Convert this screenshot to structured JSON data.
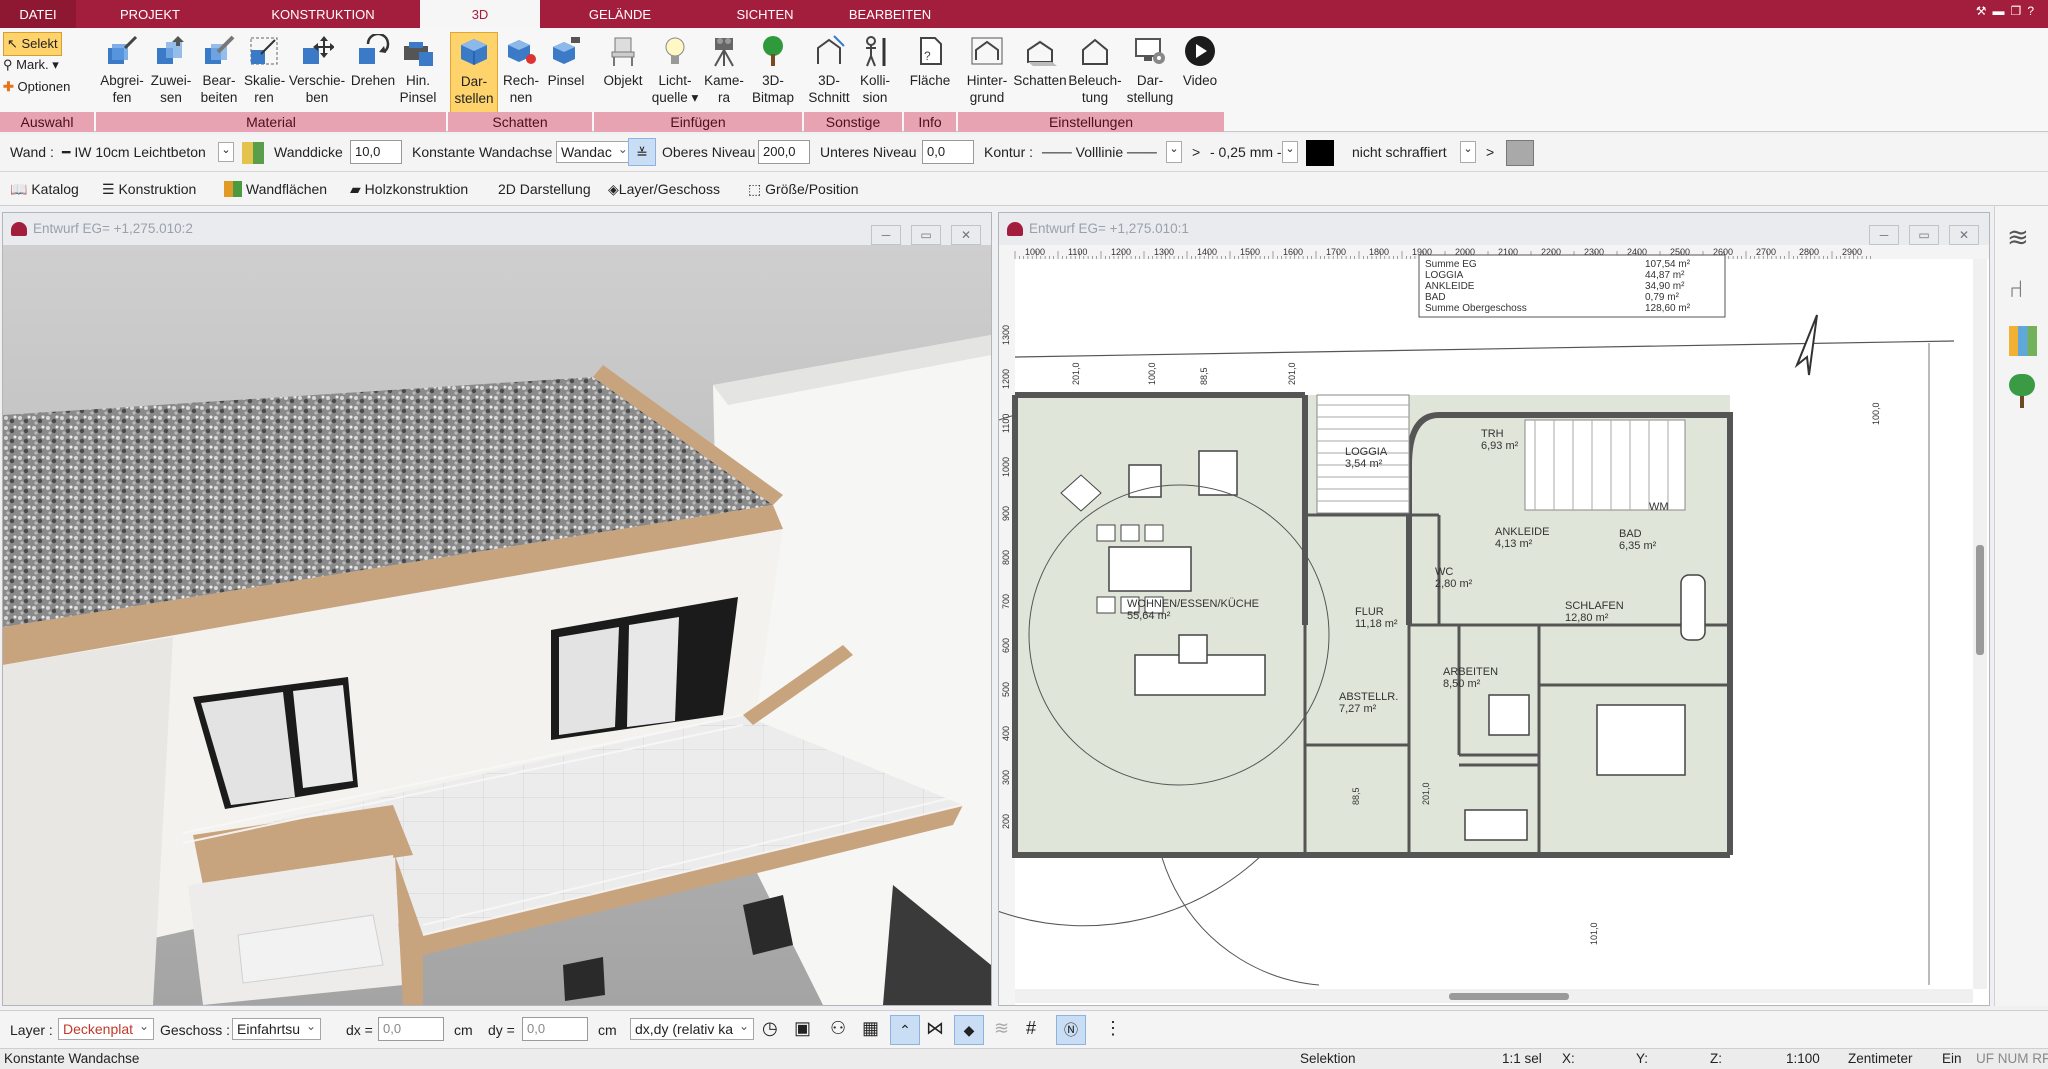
{
  "menu": {
    "tabs": [
      "DATEI",
      "PROJEKT",
      "KONSTRUKTION",
      "3D",
      "GELÄNDE",
      "SICHTEN",
      "BEARBEITEN"
    ],
    "active": "3D"
  },
  "ribbon": {
    "auswahl": {
      "selekt": "Selekt",
      "mark": "Mark.",
      "optionen": "Optionen"
    },
    "buttons": [
      {
        "l1": "Abgrei-",
        "l2": "fen"
      },
      {
        "l1": "Zuwei-",
        "l2": "sen"
      },
      {
        "l1": "Bear-",
        "l2": "beiten"
      },
      {
        "l1": "Skalie-",
        "l2": "ren"
      },
      {
        "l1": "Verschie-",
        "l2": "ben"
      },
      {
        "l1": "Drehen",
        "l2": ""
      },
      {
        "l1": "Hin.",
        "l2": "Pinsel"
      },
      {
        "l1": "Dar-",
        "l2": "stellen"
      },
      {
        "l1": "Rech-",
        "l2": "nen"
      },
      {
        "l1": "Pinsel",
        "l2": ""
      },
      {
        "l1": "Objekt",
        "l2": ""
      },
      {
        "l1": "Licht-",
        "l2": "quelle"
      },
      {
        "l1": "Kame-",
        "l2": "ra"
      },
      {
        "l1": "3D-",
        "l2": "Bitmap"
      },
      {
        "l1": "3D-",
        "l2": "Schnitt"
      },
      {
        "l1": "Kolli-",
        "l2": "sion"
      },
      {
        "l1": "Fläche",
        "l2": ""
      },
      {
        "l1": "Hinter-",
        "l2": "grund"
      },
      {
        "l1": "Schatten",
        "l2": ""
      },
      {
        "l1": "Beleuch-",
        "l2": "tung"
      },
      {
        "l1": "Dar-",
        "l2": "stellung"
      },
      {
        "l1": "Video",
        "l2": ""
      }
    ],
    "groups": [
      "Auswahl",
      "Material",
      "Schatten",
      "Einfügen",
      "Sonstige",
      "Info",
      "Einstellungen"
    ]
  },
  "props": {
    "wand_label": "Wand :",
    "wand_type": "IW 10cm Leichtbeton",
    "wanddicke_label": "Wanddicke",
    "wanddicke": "10,0",
    "achse_label": "Konstante Wandachse",
    "achse_value": "Wandac",
    "oberes_label": "Oberes Niveau",
    "oberes": "200,0",
    "unteres_label": "Unteres Niveau",
    "unteres": "0,0",
    "kontur_label": "Kontur :",
    "linie": "Volllinie",
    "staerke": "- 0,25 mm -",
    "schraffur": "nicht schraffiert",
    "arrow": ">"
  },
  "toolbar2": [
    "Katalog",
    "Konstruktion",
    "Wandflächen",
    "Holzkonstruktion",
    "2D Darstellung",
    "Layer/Geschoss",
    "Größe/Position"
  ],
  "panes": {
    "left_title": "Entwurf EG= +1,275.010:2",
    "right_title": "Entwurf EG= +1,275.010:1"
  },
  "plan": {
    "ruler": [
      "1000",
      "1100",
      "1200",
      "1300",
      "1400",
      "1500",
      "1600",
      "1700",
      "1800",
      "1900",
      "2000",
      "2100",
      "2200",
      "2300",
      "2400",
      "2500",
      "2600",
      "2700",
      "2800",
      "2900"
    ],
    "vruler": [
      "1300",
      "1200",
      "1100",
      "1000",
      "900",
      "800",
      "700",
      "600",
      "500",
      "400",
      "300",
      "200"
    ],
    "table": [
      {
        "n": "Summe EG",
        "v": "107,54 m²"
      },
      {
        "n": "LOGGIA",
        "v": "44,87 m²"
      },
      {
        "n": "ANKLEIDE",
        "v": "34,90 m²"
      },
      {
        "n": "BAD",
        "v": "0,79 m²"
      },
      {
        "n": "Summe Obergeschoss",
        "v": "128,60 m²"
      }
    ],
    "rooms": [
      {
        "n": "LOGGIA",
        "a": "3,54 m²"
      },
      {
        "n": "TRH",
        "a": "6,93 m²"
      },
      {
        "n": "ANKLEIDE",
        "a": "4,13 m²"
      },
      {
        "n": "BAD",
        "a": "6,35 m²"
      },
      {
        "n": "WC",
        "a": "2,80 m²"
      },
      {
        "n": "WOHNEN/ESSEN/KÜCHE",
        "a": "55,64 m²"
      },
      {
        "n": "FLUR",
        "a": "11,18 m²"
      },
      {
        "n": "SCHLAFEN",
        "a": "12,80 m²"
      },
      {
        "n": "ARBEITEN",
        "a": "8,50 m²"
      },
      {
        "n": "ABSTELLR.",
        "a": "7,27 m²"
      }
    ],
    "dims": [
      "201,0",
      "100,0",
      "88,5",
      "201,0",
      "88,5",
      "201,0",
      "101,0",
      "100,0"
    ],
    "wm": "WM"
  },
  "status": {
    "layer_label": "Layer :",
    "layer": "Deckenplat",
    "geschoss_label": "Geschoss :",
    "geschoss": "Einfahrtsu",
    "dx_label": "dx =",
    "dx": "0,0",
    "dy_label": "dy =",
    "dy": "0,0",
    "unit": "cm",
    "mode": "dx,dy (relativ ka"
  },
  "bottom": {
    "left": "Konstante Wandachse",
    "selektion": "Selektion",
    "sel": "1:1 sel",
    "x": "X:",
    "y": "Y:",
    "z": "Z:",
    "scale": "1:100",
    "einheit": "Zentimeter",
    "ein": "Ein",
    "flags": "UF NUM RF"
  }
}
